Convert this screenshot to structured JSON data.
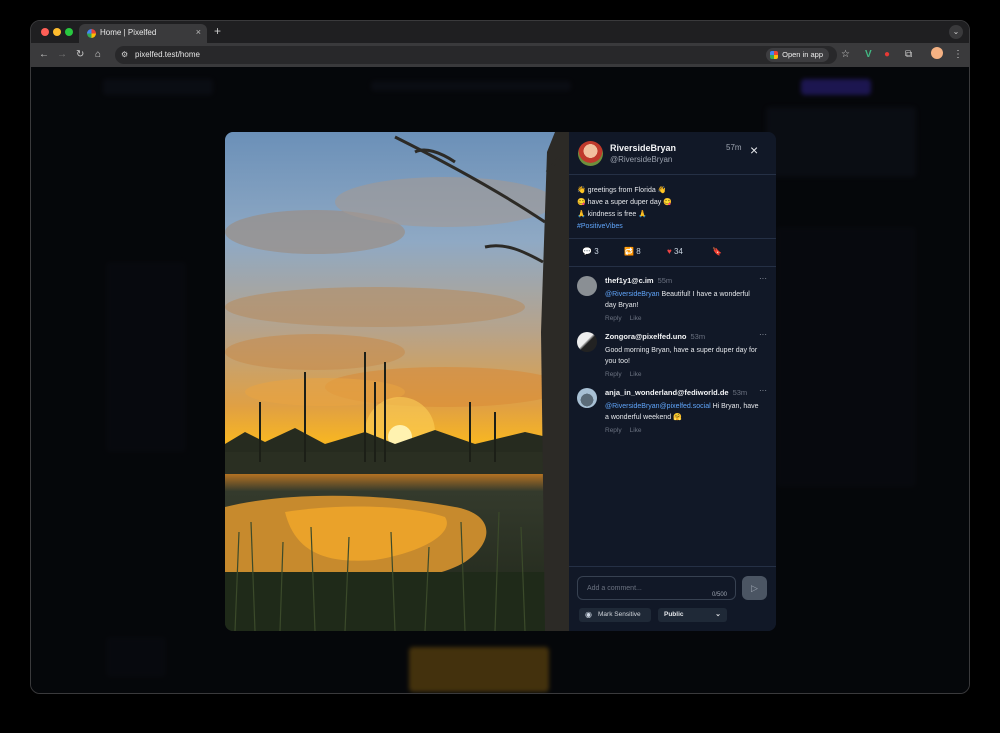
{
  "browser": {
    "tab_title": "Home | Pixelfed",
    "tab_close": "×",
    "new_tab": "+",
    "url": "pixelfed.test/home",
    "open_in_app": "Open in app"
  },
  "post": {
    "display_name": "RiversideBryan",
    "username": "@RiversideBryan",
    "time_ago": "57m",
    "close": "×",
    "caption_lines": [
      "👋 greetings from Florida 👋",
      "😋 have a super duper day 😋",
      "🙏 kindness is free 🙏"
    ],
    "hashtag": "#PositiveVibes",
    "stats": {
      "comments": "3",
      "shares": "8",
      "likes": "34"
    }
  },
  "comments": [
    {
      "author": "thef1y1@c.im",
      "time": "55m",
      "mention": "@RiversideBryan",
      "text": " Beautiful! I have a wonderful day Bryan!",
      "reply": "Reply",
      "like": "Like",
      "more": "···"
    },
    {
      "author": "Zongora@pixelfed.uno",
      "time": "53m",
      "mention": "",
      "text": "Good morning Bryan, have a super duper day for you too!",
      "reply": "Reply",
      "like": "Like",
      "more": "···"
    },
    {
      "author": "anja_in_wonderland@fediworld.de",
      "time": "53m",
      "mention": "@RiversideBryan@pixelfed.social",
      "text": " Hi Bryan, have a wonderful weekend 🤗",
      "reply": "Reply",
      "like": "Like",
      "more": "···"
    }
  ],
  "composer": {
    "placeholder": "Add a comment...",
    "char_count": "0/500",
    "mark_sensitive": "Mark Sensitive",
    "visibility": "Public"
  },
  "colors": {
    "accent": "#60a5fa",
    "like": "#ef4444",
    "panel": "#111827"
  }
}
